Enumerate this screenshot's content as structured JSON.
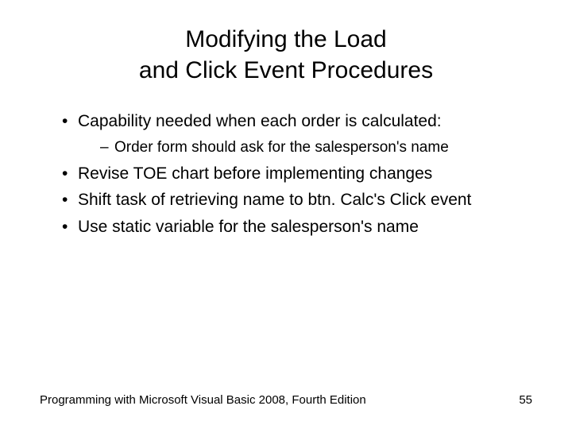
{
  "title": {
    "line1": "Modifying the Load",
    "line2": "and Click Event Procedures"
  },
  "bullets": {
    "item1": "Capability needed when each order is calculated:",
    "sub1": "Order form should ask for the salesperson's name",
    "item2": "Revise TOE chart before implementing changes",
    "item3": "Shift task of retrieving name to btn. Calc's Click event",
    "item4": "Use static variable for the salesperson's name"
  },
  "footer": {
    "text": "Programming with Microsoft Visual Basic 2008, Fourth Edition",
    "page": "55"
  }
}
